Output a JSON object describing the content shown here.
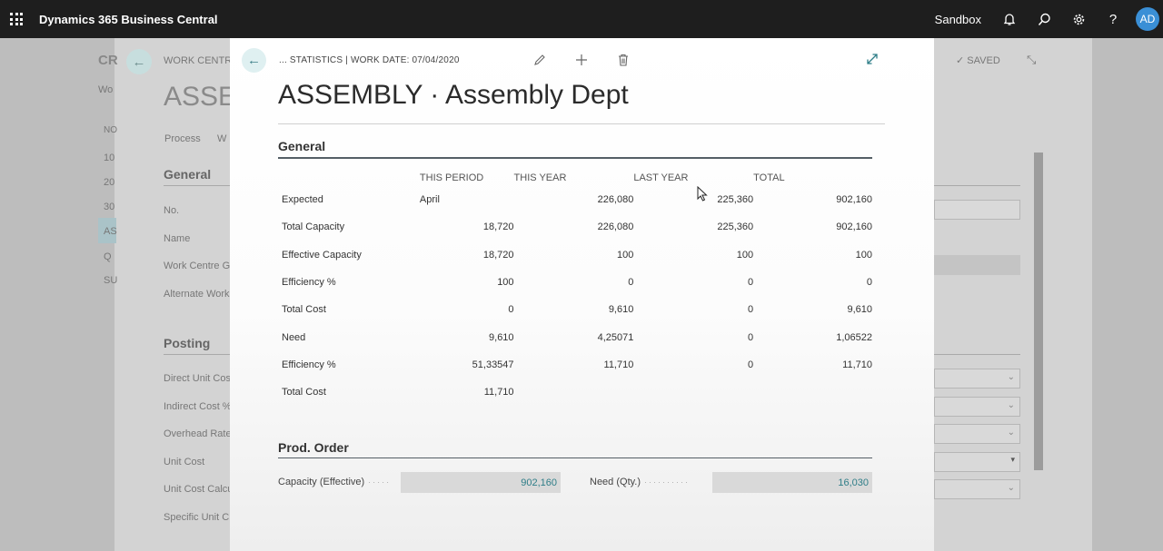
{
  "topbar": {
    "app_title": "Dynamics 365 Business Central",
    "environment": "Sandbox",
    "avatar_initials": "AD"
  },
  "background": {
    "breadcrumb": "WORK CENTRE",
    "title": "ASSE",
    "status": "SAVED",
    "tabs": [
      "Process",
      "W"
    ],
    "left_labels": [
      "CR",
      "Wo",
      "NO",
      "10",
      "20",
      "30",
      "AS",
      "Q",
      "SU"
    ],
    "general_heading": "General",
    "general_fields": [
      "No.",
      "Name",
      "Work Centre G",
      "Alternate Work"
    ],
    "posting_heading": "Posting",
    "posting_fields": [
      "Direct Unit Cos",
      "Indirect Cost %",
      "Overhead Rate",
      "Unit Cost",
      "Unit Cost Calcu",
      "Specific Unit C"
    ]
  },
  "modal": {
    "breadcrumb": "... STATISTICS | WORK DATE: 07/04/2020",
    "title": "ASSEMBLY · Assembly Dept",
    "general": {
      "heading": "General",
      "columns": [
        "THIS PERIOD",
        "THIS YEAR",
        "LAST YEAR",
        "TOTAL"
      ],
      "rows": [
        {
          "label": "Expected",
          "values": [
            "April",
            "226,080",
            "225,360",
            "902,160"
          ]
        },
        {
          "label": "Total Capacity",
          "values": [
            "18,720",
            "226,080",
            "225,360",
            "902,160"
          ]
        },
        {
          "label": "Effective Capacity",
          "values": [
            "18,720",
            "100",
            "100",
            "100"
          ]
        },
        {
          "label": "Efficiency %",
          "values": [
            "100",
            "0",
            "0",
            "0"
          ]
        },
        {
          "label": "Total Cost",
          "values": [
            "0",
            "9,610",
            "0",
            "9,610"
          ]
        },
        {
          "label": "Need",
          "values": [
            "9,610",
            "4,25071",
            "0",
            "1,06522"
          ]
        },
        {
          "label": "Efficiency %",
          "values": [
            "51,33547",
            "11,710",
            "0",
            "11,710"
          ]
        },
        {
          "label": "Total Cost",
          "values": [
            "11,710",
            "",
            "",
            ""
          ]
        }
      ]
    },
    "prod_order": {
      "heading": "Prod. Order",
      "capacity_label": "Capacity (Effective)",
      "capacity_value": "902,160",
      "need_label": "Need (Qty.)",
      "need_value": "16,030"
    }
  }
}
